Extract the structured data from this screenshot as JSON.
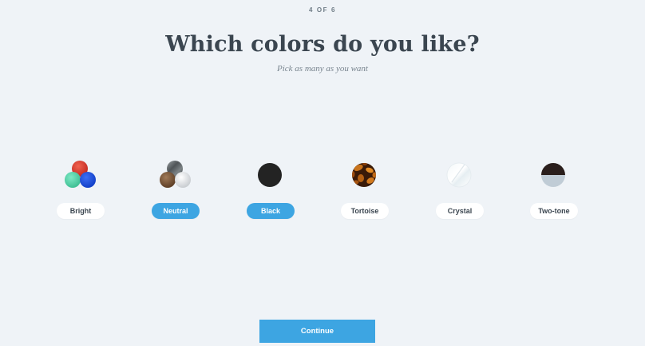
{
  "header": {
    "step": "4 OF 6",
    "title": "Which colors do you like?",
    "subtitle": "Pick as many as you want"
  },
  "options": [
    {
      "label": "Bright",
      "selected": false,
      "icon": "bright-swatch"
    },
    {
      "label": "Neutral",
      "selected": true,
      "icon": "neutral-swatch"
    },
    {
      "label": "Black",
      "selected": true,
      "icon": "black-swatch"
    },
    {
      "label": "Tortoise",
      "selected": false,
      "icon": "tortoise-swatch"
    },
    {
      "label": "Crystal",
      "selected": false,
      "icon": "crystal-swatch"
    },
    {
      "label": "Two-tone",
      "selected": false,
      "icon": "two-tone-swatch"
    }
  ],
  "footer": {
    "continue_label": "Continue"
  },
  "colors": {
    "background": "#eff3f7",
    "accent": "#3da5e2",
    "title_text": "#3b4650",
    "pill_bg": "#ffffff"
  }
}
